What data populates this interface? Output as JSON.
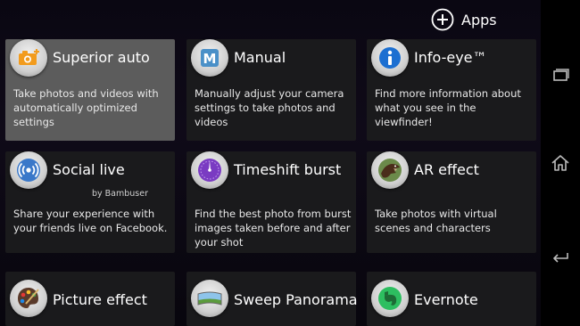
{
  "header": {
    "apps_label": "Apps"
  },
  "tiles": [
    {
      "title": "Superior auto",
      "desc": "Take photos and videos with automatically optimized settings",
      "icon": "superior-auto-icon"
    },
    {
      "title": "Manual",
      "desc": "Manually adjust your camera settings to take photos and videos",
      "icon": "manual-m-icon"
    },
    {
      "title": "Info-eye™",
      "desc": "Find more information about what you see in the viewfinder!",
      "icon": "info-icon"
    },
    {
      "title": "Social live",
      "subtitle": "by Bambuser",
      "desc": "Share your experience with your friends live on Facebook.",
      "icon": "broadcast-icon"
    },
    {
      "title": "Timeshift burst",
      "desc": "Find the best photo from burst images taken before and after your shot",
      "icon": "timeshift-dial-icon"
    },
    {
      "title": "AR effect",
      "desc": "Take photos with virtual scenes and characters",
      "icon": "dinosaur-icon"
    },
    {
      "title": "Picture effect",
      "desc": "",
      "icon": "palette-icon"
    },
    {
      "title": "Sweep Panorama",
      "desc": "",
      "icon": "panorama-landscape-icon"
    },
    {
      "title": "Evernote",
      "desc": "",
      "icon": "evernote-elephant-icon"
    }
  ],
  "navbar": {
    "icons": [
      "recent-apps-icon",
      "home-icon",
      "back-icon"
    ]
  }
}
